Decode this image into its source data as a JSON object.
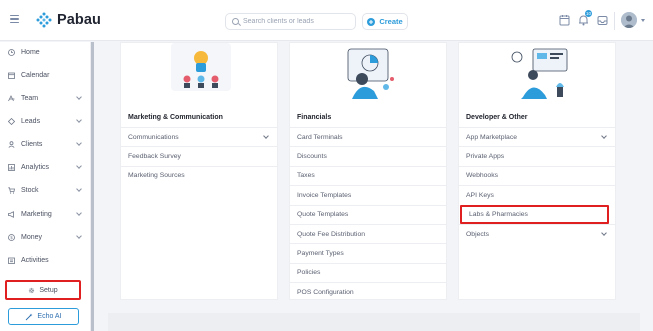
{
  "app": {
    "name": "Pabau"
  },
  "header": {
    "search_placeholder": "Search clients or leads",
    "create_label": "Create",
    "notification_count": "10"
  },
  "sidebar": {
    "items": [
      {
        "label": "Home",
        "icon": "clock-icon",
        "has_chevron": false
      },
      {
        "label": "Calendar",
        "icon": "calendar-icon",
        "has_chevron": false
      },
      {
        "label": "Team",
        "icon": "team-icon",
        "has_chevron": true
      },
      {
        "label": "Leads",
        "icon": "leads-icon",
        "has_chevron": true
      },
      {
        "label": "Clients",
        "icon": "user-icon",
        "has_chevron": true
      },
      {
        "label": "Analytics",
        "icon": "analytics-icon",
        "has_chevron": true
      },
      {
        "label": "Stock",
        "icon": "cart-icon",
        "has_chevron": true
      },
      {
        "label": "Marketing",
        "icon": "megaphone-icon",
        "has_chevron": true
      },
      {
        "label": "Money",
        "icon": "money-icon",
        "has_chevron": true
      },
      {
        "label": "Activities",
        "icon": "activities-icon",
        "has_chevron": false
      }
    ],
    "setup_label": "Setup",
    "echo_label": "Echo AI"
  },
  "cards": [
    {
      "title": "Marketing & Communication",
      "rows": [
        {
          "label": "Communications",
          "chevron": true
        },
        {
          "label": "Feedback Survey",
          "chevron": false
        },
        {
          "label": "Marketing Sources",
          "chevron": false
        }
      ]
    },
    {
      "title": "Financials",
      "rows": [
        {
          "label": "Card Terminals",
          "chevron": false
        },
        {
          "label": "Discounts",
          "chevron": false
        },
        {
          "label": "Taxes",
          "chevron": false
        },
        {
          "label": "Invoice Templates",
          "chevron": false
        },
        {
          "label": "Quote Templates",
          "chevron": false
        },
        {
          "label": "Quote Fee Distribution",
          "chevron": false
        },
        {
          "label": "Payment Types",
          "chevron": false
        },
        {
          "label": "Policies",
          "chevron": false
        },
        {
          "label": "POS Configuration",
          "chevron": false
        }
      ]
    },
    {
      "title": "Developer & Other",
      "rows": [
        {
          "label": "App Marketplace",
          "chevron": true
        },
        {
          "label": "Private Apps",
          "chevron": false
        },
        {
          "label": "Webhooks",
          "chevron": false
        },
        {
          "label": "API Keys",
          "chevron": false
        },
        {
          "label": "Labs & Pharmacies",
          "chevron": false,
          "highlighted": true
        },
        {
          "label": "Objects",
          "chevron": true
        }
      ]
    }
  ],
  "colors": {
    "accent": "#2d9cdb",
    "highlight": "#e02020"
  }
}
